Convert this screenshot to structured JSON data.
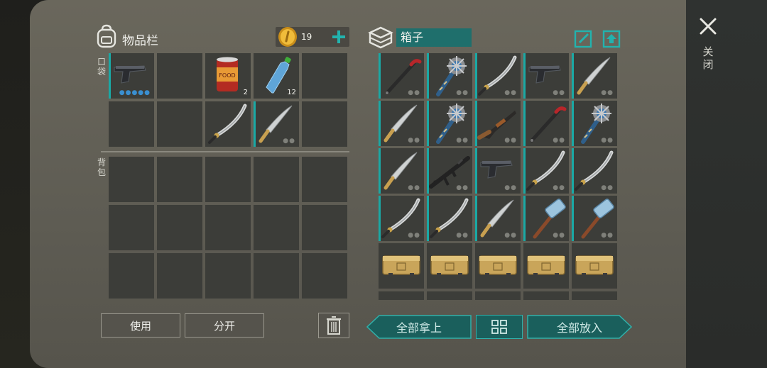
{
  "inventory": {
    "title": "物品栏",
    "coins": "19",
    "pocket_label": "口袋",
    "backpack_label": "背包",
    "pocket_slots": [
      {
        "item": "pistol-icon",
        "count": "",
        "dots": "blue"
      },
      {
        "item": "",
        "count": ""
      },
      {
        "item": "canned-food-icon",
        "count": "2"
      },
      {
        "item": "water-bottle-icon",
        "count": "12"
      },
      {
        "item": "",
        "count": ""
      },
      {
        "item": "",
        "count": ""
      },
      {
        "item": "",
        "count": ""
      },
      {
        "item": "katana-icon",
        "count": ""
      },
      {
        "item": "machete-icon",
        "count": ""
      },
      {
        "item": "",
        "count": ""
      }
    ]
  },
  "buttons": {
    "use": "使用",
    "split": "分开",
    "take_all": "全部拿上",
    "put_all": "全部放入",
    "close_label": "关闭"
  },
  "container": {
    "name": "箱子",
    "items": [
      "crowbar-icon",
      "spiked-club-icon",
      "katana-icon",
      "pistol-icon",
      "machete-icon",
      "machete-icon",
      "spiked-club-icon",
      "shotgun-icon",
      "crowbar-icon",
      "spiked-club-icon",
      "machete-icon",
      "assault-rifle-icon",
      "pistol-icon",
      "katana-icon",
      "katana-icon",
      "katana-icon",
      "katana-icon",
      "machete-icon",
      "sledgehammer-icon",
      "sledgehammer-icon",
      "ammo-box-icon",
      "ammo-box-icon",
      "ammo-box-icon",
      "ammo-box-icon",
      "ammo-box-icon"
    ]
  },
  "colors": {
    "accent": "#1aa9a5",
    "slot": "#3c3d39",
    "panel": "#625f56"
  }
}
